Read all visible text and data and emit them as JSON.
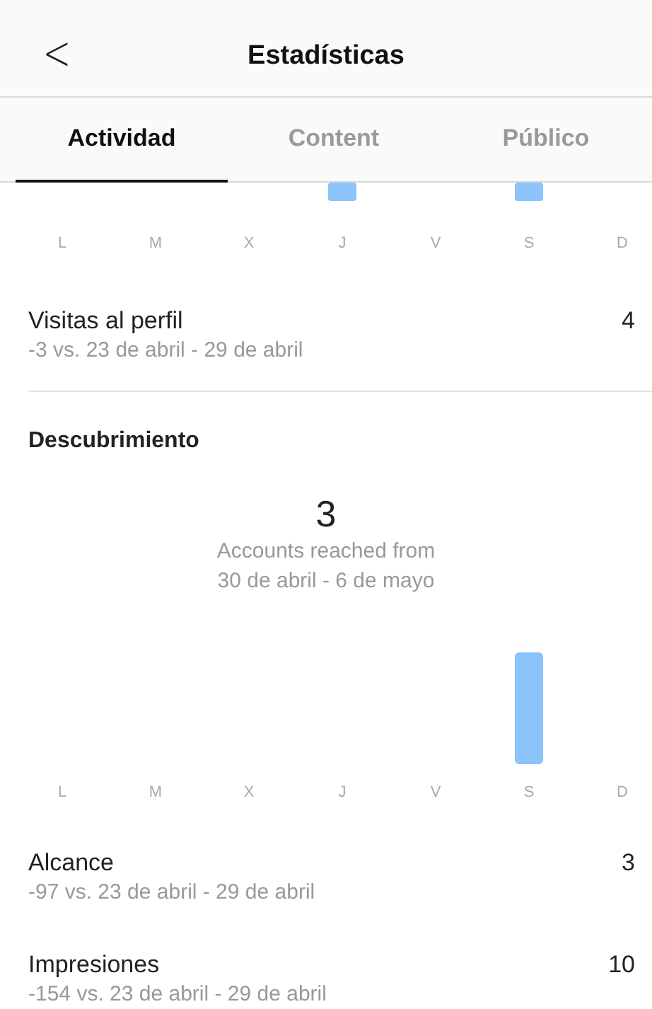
{
  "header": {
    "back": "<",
    "title": "Estadísticas"
  },
  "tabs": [
    {
      "label": "Actividad",
      "selected": true
    },
    {
      "label": "Content",
      "selected": false
    },
    {
      "label": "Público",
      "selected": false
    }
  ],
  "top_chart": {
    "days": [
      "L",
      "M",
      "X",
      "J",
      "V",
      "S",
      "D"
    ]
  },
  "profile_visits": {
    "label": "Visitas al perfil",
    "value": "4",
    "comparison": "-3 vs. 23 de abril - 29 de abril"
  },
  "discovery": {
    "title": "Descubrimiento",
    "total": "3",
    "caption": "Accounts reached from",
    "range": "30 de abril - 6 de mayo",
    "days": [
      "L",
      "M",
      "X",
      "J",
      "V",
      "S",
      "D"
    ],
    "metrics": [
      {
        "label": "Alcance",
        "value": "3",
        "comparison": "-97 vs. 23 de abril - 29 de abril"
      },
      {
        "label": "Impresiones",
        "value": "10",
        "comparison": "-154 vs. 23 de abril - 29 de abril"
      }
    ]
  }
}
